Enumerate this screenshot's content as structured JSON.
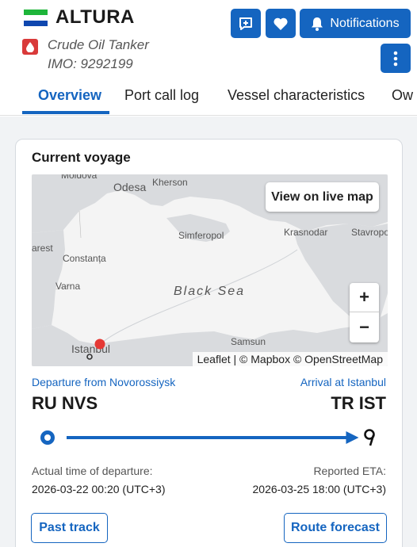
{
  "vessel": {
    "name": "ALTURA",
    "type": "Crude Oil Tanker",
    "imo": "IMO: 9292199",
    "flag_colors": [
      "#1eb53a",
      "#ffffff",
      "#0f47af"
    ]
  },
  "header_buttons": {
    "add_icon": "add-to-fleet-icon",
    "favorite_icon": "heart-icon",
    "notifications_label": "Notifications",
    "notifications_icon": "bell-icon",
    "more_icon": "more-vertical-icon"
  },
  "tabs": [
    {
      "label": "Overview",
      "active": true
    },
    {
      "label": "Port call log",
      "active": false
    },
    {
      "label": "Vessel characteristics",
      "active": false
    },
    {
      "label": "Ow",
      "active": false
    }
  ],
  "voyage": {
    "title": "Current voyage",
    "map": {
      "live_map_button": "View on live map",
      "zoom_in": "+",
      "zoom_out": "−",
      "attribution": "Leaflet | © Mapbox © OpenStreetMap",
      "sea_label": "Black Sea",
      "place_labels": [
        "Odesa",
        "Kherson",
        "Simferopol",
        "Krasnodar",
        "Stavropo",
        "arest",
        "Constanța",
        "Varna",
        "Samsun",
        "Istanbul"
      ],
      "vessel_marker_color": "#e53935"
    },
    "departure_label": "Departure from Novorossiysk",
    "departure_code": "RU NVS",
    "arrival_label": "Arrival at Istanbul",
    "arrival_code": "TR IST",
    "progress_fraction": 0.98,
    "atd_label": "Actual time of departure:",
    "atd_value": "2026-03-22 00:20 (UTC+3)",
    "eta_label": "Reported ETA:",
    "eta_value": "2026-03-25 18:00 (UTC+3)",
    "past_track_button": "Past track",
    "route_forecast_button": "Route forecast"
  },
  "colors": {
    "accent": "#1565c0",
    "tanker_badge": "#d93a3a"
  }
}
